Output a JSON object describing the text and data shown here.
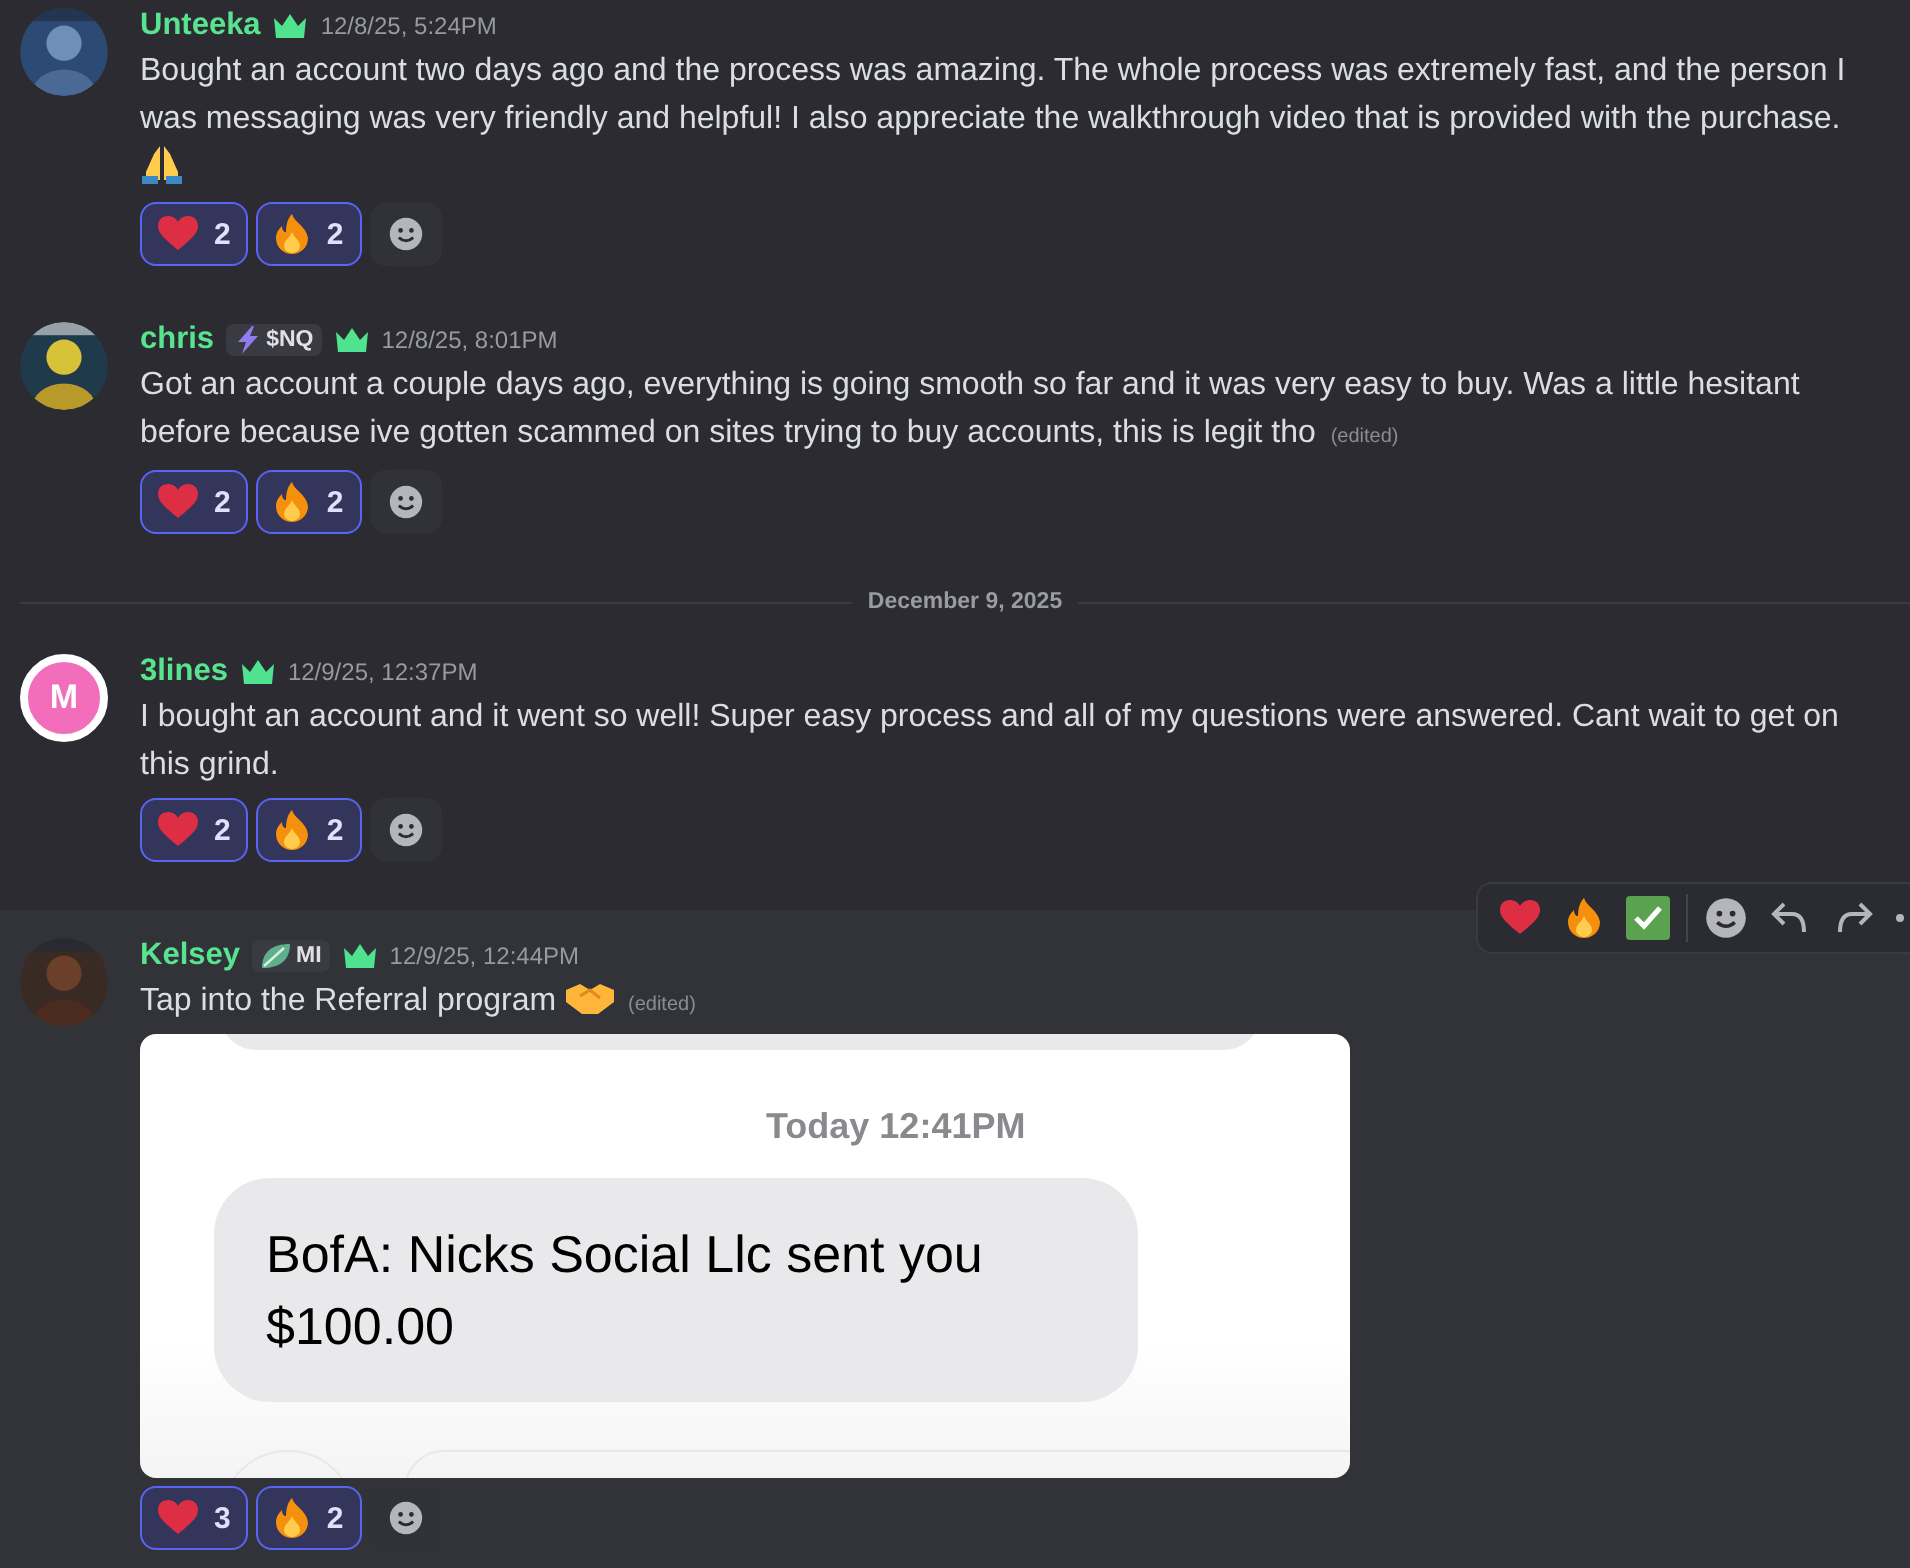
{
  "messages": [
    {
      "author": "Unteeka",
      "crown": true,
      "time": "12/8/25, 5:24PM",
      "hovered": false,
      "text": "Bought an account two days ago and the process was amazing. The whole process was extremely fast, and the person I was messaging was very friendly and helpful! I also appreciate the walkthrough video that is provided with the purchase.",
      "emoji": {
        "kind": "pray"
      },
      "reactions": [
        {
          "kind": "heart",
          "count": "2",
          "selected": true
        },
        {
          "kind": "fire",
          "count": "2",
          "selected": true
        }
      ]
    },
    {
      "author": "chris",
      "tag": {
        "kind": "lightning",
        "text": "$NQ"
      },
      "crown": true,
      "time": "12/8/25, 8:01PM",
      "hovered": false,
      "text": "Got an account a couple days ago, everything is going smooth so far and it was very easy to buy. Was a little hesitant before because ive gotten scammed on sites trying to buy accounts, this is legit tho",
      "edited": "(edited)",
      "reactions": [
        {
          "kind": "heart",
          "count": "2",
          "selected": true
        },
        {
          "kind": "fire",
          "count": "2",
          "selected": true
        }
      ]
    },
    {
      "divider": "December 9, 2025"
    },
    {
      "author": "3lines",
      "crown": true,
      "time": "12/9/25, 12:37PM",
      "avatar": {
        "kind": "letter",
        "text": "M"
      },
      "hovered": false,
      "text": "I bought an account and it went so well! Super easy process and all of my questions were answered. Cant wait to get on this grind.",
      "reactions": [
        {
          "kind": "heart",
          "count": "2",
          "selected": true
        },
        {
          "kind": "fire",
          "count": "2",
          "selected": true
        }
      ]
    },
    {
      "author": "Kelsey",
      "tag": {
        "kind": "leaf",
        "text": "MI"
      },
      "crown": true,
      "time": "12/9/25, 12:44PM",
      "hovered": true,
      "text": "Tap into the Referral program",
      "emoji": {
        "kind": "handshake"
      },
      "edited": "(edited)",
      "attachment": {
        "timestamp": "Today 12:41PM",
        "message": "BofA: Nicks Social Llc sent you $100.00"
      },
      "reactions": [
        {
          "kind": "heart",
          "count": "3",
          "selected": true
        },
        {
          "kind": "fire",
          "count": "2",
          "selected": true
        }
      ]
    }
  ],
  "toolbar": [
    {
      "kind": "heart"
    },
    {
      "kind": "fire"
    },
    {
      "kind": "check"
    },
    {
      "kind": "separator"
    },
    {
      "kind": "add-reaction"
    },
    {
      "kind": "reply"
    },
    {
      "kind": "forward"
    },
    {
      "kind": "more"
    }
  ]
}
